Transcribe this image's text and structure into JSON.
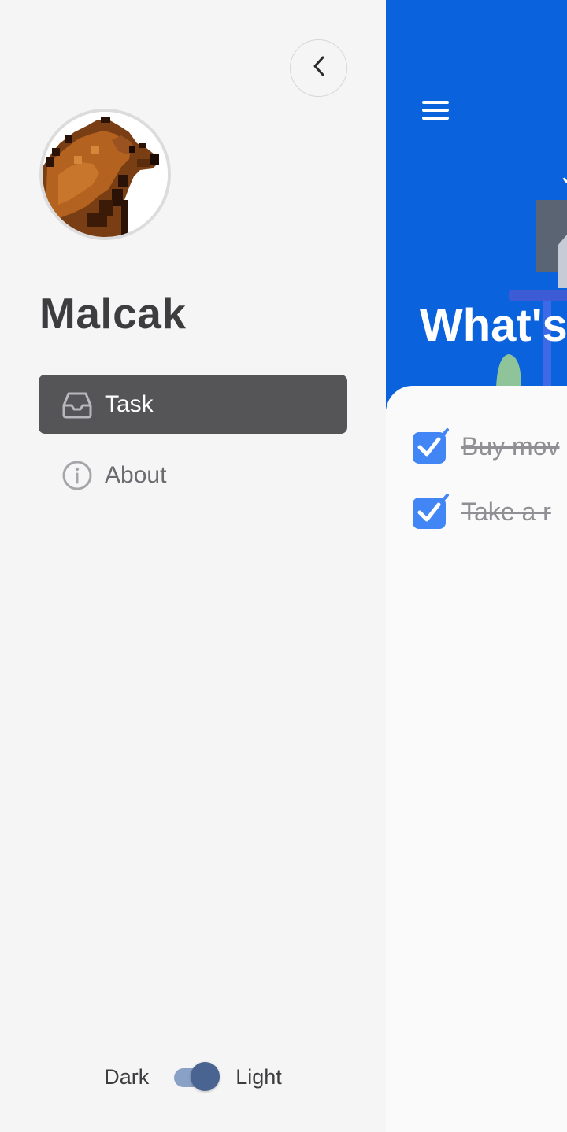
{
  "drawer": {
    "username": "Malcak",
    "nav": [
      {
        "label": "Task",
        "icon": "inbox-icon",
        "active": true
      },
      {
        "label": "About",
        "icon": "info-circle-icon",
        "active": false
      }
    ],
    "theme": {
      "dark_label": "Dark",
      "light_label": "Light",
      "mode": "light"
    }
  },
  "main": {
    "title": "What's",
    "tasks": [
      {
        "text": "Buy mov",
        "done": true
      },
      {
        "text": "Take a r",
        "done": true
      }
    ]
  },
  "colors": {
    "primary": "#0b62dd",
    "active_nav": "#555557",
    "checkbox": "#4285f4"
  }
}
